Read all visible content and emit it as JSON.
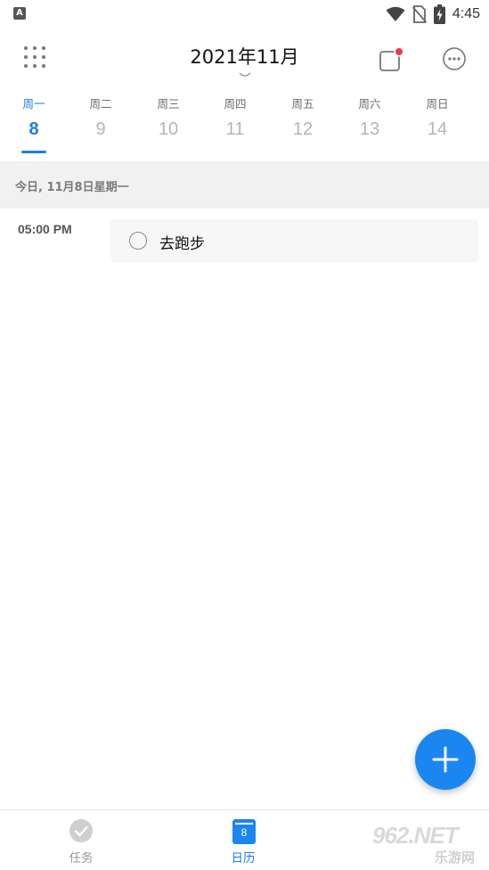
{
  "status_bar": {
    "left_icon_letter": "A",
    "time": "4:45",
    "icons": [
      "wifi-icon",
      "no-sim-icon",
      "battery-charging-icon"
    ]
  },
  "header": {
    "title": "2021年11月",
    "grid_icon": "apps-grid-icon",
    "notification_icon": "notification-square-icon",
    "more_icon": "more-horizontal-icon",
    "accent_color": "#1a7ee6",
    "badge_color": "#f0364f"
  },
  "week": {
    "days": [
      {
        "name": "周一",
        "num": "8",
        "active": true
      },
      {
        "name": "周二",
        "num": "9",
        "active": false
      },
      {
        "name": "周三",
        "num": "10",
        "active": false
      },
      {
        "name": "周四",
        "num": "11",
        "active": false
      },
      {
        "name": "周五",
        "num": "12",
        "active": false
      },
      {
        "name": "周六",
        "num": "13",
        "active": false
      },
      {
        "name": "周日",
        "num": "14",
        "active": false
      }
    ]
  },
  "date_bar": {
    "text": "今日, 11月8日星期一"
  },
  "events": [
    {
      "time": "05:00 PM",
      "title": "去跑步",
      "done": false
    }
  ],
  "fab": {
    "icon": "plus-icon",
    "color": "#1a86f0"
  },
  "bottom_nav": {
    "items": [
      {
        "label": "任务",
        "icon": "check-circle-icon",
        "active": false
      },
      {
        "label": "日历",
        "icon": "calendar-icon",
        "icon_text": "8",
        "active": true
      }
    ]
  },
  "watermark": {
    "main": "962.NET",
    "sub": "乐游网"
  }
}
